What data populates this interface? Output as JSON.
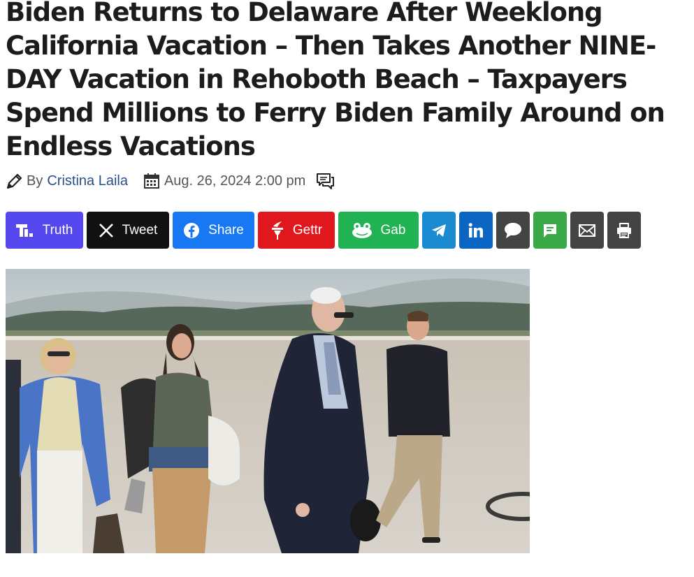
{
  "article": {
    "headline": "Biden Returns to Delaware After Weeklong California Vacation – Then Takes Another NINE-DAY Vacation in Rehoboth Beach – Taxpayers Spend Millions to Ferry Biden Family Around on Endless Vacations",
    "by_label": "By",
    "author": "Cristina Laila",
    "date": "Aug. 26, 2024 2:00 pm"
  },
  "share": {
    "truth": {
      "label": "Truth",
      "color": "#5448ee",
      "icon": "truth-social-icon"
    },
    "tweet": {
      "label": "Tweet",
      "color": "#111111",
      "icon": "x-icon"
    },
    "facebook": {
      "label": "Share",
      "color": "#1877f2",
      "icon": "facebook-icon"
    },
    "gettr": {
      "label": "Gettr",
      "color": "#e1171e",
      "icon": "gettr-icon"
    },
    "gab": {
      "label": "Gab",
      "color": "#21b353",
      "icon": "gab-frog-icon"
    },
    "telegram": {
      "color": "#1c8ad0",
      "icon": "telegram-icon"
    },
    "linkedin": {
      "color": "#0a66c2",
      "icon": "linkedin-icon"
    },
    "comment": {
      "color": "#444444",
      "icon": "speech-bubble-icon"
    },
    "sms": {
      "color": "#3aaa48",
      "icon": "sms-icon"
    },
    "email": {
      "color": "#444444",
      "icon": "envelope-icon"
    },
    "print": {
      "color": "#444444",
      "icon": "printer-icon"
    }
  },
  "image": {
    "subject": "photo-people-on-airport-tarmac"
  }
}
